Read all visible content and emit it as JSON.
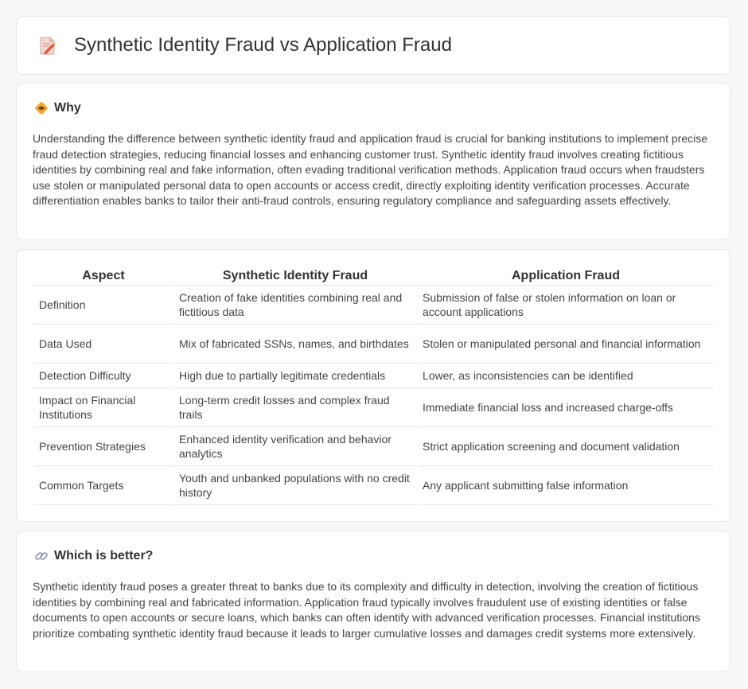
{
  "header": {
    "title": "Synthetic Identity Fraud vs Application Fraud",
    "icon": "document-pencil-icon"
  },
  "why": {
    "icon": "warning-diamond-icon",
    "title": "Why",
    "text": "Understanding the difference between synthetic identity fraud and application fraud is crucial for banking institutions to implement precise fraud detection strategies, reducing financial losses and enhancing customer trust. Synthetic identity fraud involves creating fictitious identities by combining real and fake information, often evading traditional verification methods. Application fraud occurs when fraudsters use stolen or manipulated personal data to open accounts or access credit, directly exploiting identity verification processes. Accurate differentiation enables banks to tailor their anti-fraud controls, ensuring regulatory compliance and safeguarding assets effectively."
  },
  "comparison": {
    "headers": [
      "Aspect",
      "Synthetic Identity Fraud",
      "Application Fraud"
    ],
    "rows": [
      [
        "Definition",
        "Creation of fake identities combining real and fictitious data",
        "Submission of false or stolen information on loan or account applications"
      ],
      [
        "Data Used",
        "Mix of fabricated SSNs, names, and birthdates",
        "Stolen or manipulated personal and financial information"
      ],
      [
        "Detection Difficulty",
        "High due to partially legitimate credentials",
        "Lower, as inconsistencies can be identified"
      ],
      [
        "Impact on Financial Institutions",
        "Long-term credit losses and complex fraud trails",
        "Immediate financial loss and increased charge-offs"
      ],
      [
        "Prevention Strategies",
        "Enhanced identity verification and behavior analytics",
        "Strict application screening and document validation"
      ],
      [
        "Common Targets",
        "Youth and unbanked populations with no credit history",
        "Any applicant submitting false information"
      ]
    ]
  },
  "better": {
    "icon": "link-icon",
    "title": "Which is better?",
    "text": "Synthetic identity fraud poses a greater threat to banks due to its complexity and difficulty in detection, involving the creation of fictitious identities by combining real and fabricated information. Application fraud typically involves fraudulent use of existing identities or false documents to open accounts or secure loans, which banks can often identify with advanced verification processes. Financial institutions prioritize combating synthetic identity fraud because it leads to larger cumulative losses and damages credit systems more extensively."
  }
}
